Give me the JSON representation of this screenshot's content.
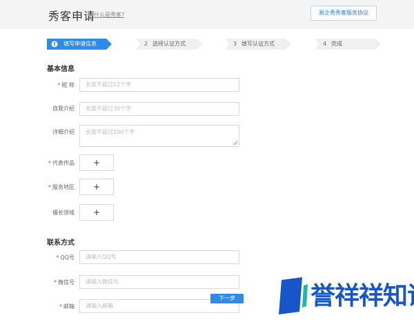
{
  "header": {
    "title": "秀客申请",
    "help_link": "什么是秀客?",
    "agreement_button": "易企秀秀客服务协议"
  },
  "steps": [
    {
      "num": "1",
      "label": "填写申请信息",
      "active": true
    },
    {
      "num": "2",
      "label": "选择认证方式",
      "active": false
    },
    {
      "num": "3",
      "label": "填写认证方式",
      "active": false
    },
    {
      "num": "4",
      "label": "完成",
      "active": false
    }
  ],
  "basic_info": {
    "section_title": "基本信息",
    "nickname": {
      "label": "昵 称",
      "required": true,
      "placeholder": "长度不超过12个字"
    },
    "self_intro": {
      "label": "自我介绍",
      "required": false,
      "placeholder": "长度不超过30个字"
    },
    "detail_intro": {
      "label": "详细介绍",
      "required": false,
      "placeholder": "长度不超过200个字"
    },
    "works": {
      "label": "代表作品",
      "required": true,
      "add": "+"
    },
    "service_area": {
      "label": "服务地区",
      "required": true,
      "add": "+"
    },
    "expertise": {
      "label": "擅长领域",
      "required": false,
      "add": "+"
    }
  },
  "contact": {
    "section_title": "联系方式",
    "qq": {
      "label": "QQ号",
      "required": true,
      "placeholder": "请输入QQ号"
    },
    "wechat": {
      "label": "微信号",
      "required": true,
      "placeholder": "请输入微信号"
    },
    "email": {
      "label": "邮箱",
      "required": true,
      "placeholder": "请输入邮箱"
    }
  },
  "next_button": "下一步",
  "watermark": {
    "text": "誉祥祥知识"
  },
  "colors": {
    "accent": "#2e8ce8",
    "required": "#e4393c",
    "step_inactive": "#f0f0f0",
    "watermark_blue": "#1756c9",
    "watermark_teal": "#1fb8a8"
  }
}
